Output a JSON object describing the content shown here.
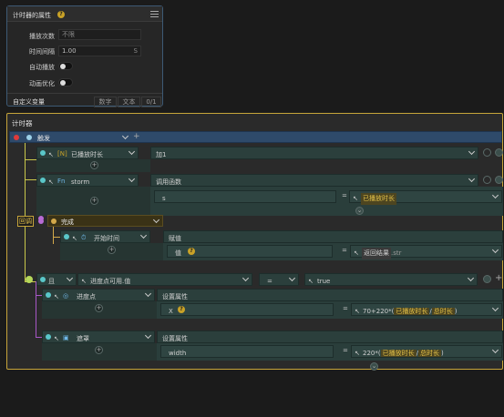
{
  "props": {
    "title": "计时器的属性",
    "rows": [
      {
        "label": "播放次数",
        "value": "不限"
      },
      {
        "label": "时间间隔",
        "value": "1.00",
        "unit": "S"
      }
    ],
    "auto_play_label": "自动播放",
    "anim_opt_label": "动画优化",
    "custom_var_label": "自定义变量",
    "tags": [
      "数字",
      "文本",
      "0/1"
    ]
  },
  "timer": {
    "title": "计时器",
    "trigger_label": "触发",
    "callback_label": "回调",
    "complete_label": "完成",
    "blocks": {
      "played": {
        "object": "已播放时长",
        "action": "加1"
      },
      "storm": {
        "object": "storm",
        "action": "调用函数",
        "param": "s",
        "value": "已播放时长"
      },
      "start_time": {
        "object": "开始时间",
        "action": "赋值",
        "param": "值",
        "value_text": "返回结果",
        "value_suffix": ".str"
      },
      "if_block": {
        "keyword": "且",
        "cond": "进度点可用.值",
        "op": "=",
        "value": "true"
      },
      "progress": {
        "object": "进度点",
        "action": "设置属性",
        "param": "X",
        "expr_prefix": "70+220*(",
        "expr_a": "已播放时长",
        "expr_sep": "/",
        "expr_b": "总时长",
        "expr_end": ")"
      },
      "mask": {
        "object": "遮罩",
        "action": "设置属性",
        "param": "width",
        "expr_prefix": "220*(",
        "expr_a": "已播放时长",
        "expr_sep": "/",
        "expr_b": "总时长",
        "expr_end": ")"
      }
    }
  },
  "colors": {
    "accent_gold": "#c7a53a",
    "highlight": "#e6c44a",
    "panel_border": "#3d5a75"
  }
}
